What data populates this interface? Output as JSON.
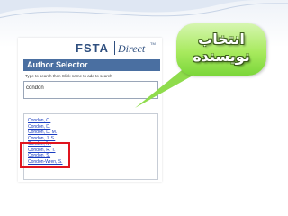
{
  "header": {
    "brand": "FSTA",
    "brand_suffix": "Direct",
    "trademark": "TM"
  },
  "author_selector": {
    "title": "Author Selector",
    "hint": "Type to search then Click name to add to search",
    "search_value": "condon",
    "results": [
      "Condon, C.",
      "Condon, D.",
      "Condon, D. M.",
      "Condon, J. S.",
      "Condon, M.",
      "Condon, R. T.",
      "Condon, S.",
      "Condon-Wren, S."
    ]
  },
  "callout": {
    "line1": "انتخاب",
    "line2": "نویسنده",
    "color": "#9be35a"
  },
  "highlight_color": "#e0141f"
}
